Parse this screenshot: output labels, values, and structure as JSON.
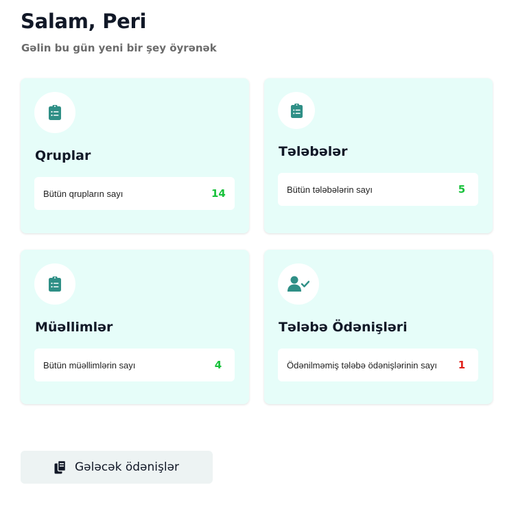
{
  "header": {
    "greeting": "Salam, Peri",
    "subtitle": "Gəlin bu gün yeni bir şey öyrənək"
  },
  "cards": [
    {
      "title": "Qruplar",
      "icon": "clipboard-list-icon",
      "stat_label": "Bütün qrupların sayı",
      "stat_value": "14",
      "value_color": "#17c13a"
    },
    {
      "title": "Tələbələr",
      "icon": "clipboard-list-icon",
      "stat_label": "Bütün tələbələrin sayı",
      "stat_value": "5",
      "value_color": "#17c13a"
    },
    {
      "title": "Müəllimlər",
      "icon": "clipboard-list-icon",
      "stat_label": "Bütün müəllimlərin sayı",
      "stat_value": "4",
      "value_color": "#17c13a"
    },
    {
      "title": "Tələbə Ödənişləri",
      "icon": "user-check-icon",
      "stat_label": "Ödənilməmiş tələbə ödənişlərinin sayı",
      "stat_value": "1",
      "value_color": "#e0201a"
    }
  ],
  "footer": {
    "future_payments_label": "Gələcək ödənişlər",
    "future_payments_icon": "copy-icon"
  },
  "colors": {
    "accent": "#2f8f86",
    "card_bg": "#e6fdf9",
    "positive": "#17c13a",
    "negative": "#e0201a"
  }
}
